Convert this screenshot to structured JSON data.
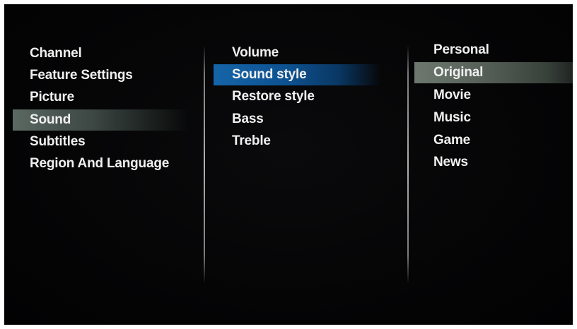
{
  "main_menu": {
    "items": [
      {
        "label": "Channel"
      },
      {
        "label": "Feature Settings"
      },
      {
        "label": "Picture"
      },
      {
        "label": "Sound"
      },
      {
        "label": "Subtitles"
      },
      {
        "label": "Region And Language"
      }
    ],
    "selected": "Sound"
  },
  "sound_menu": {
    "items": [
      {
        "label": "Volume"
      },
      {
        "label": "Sound style"
      },
      {
        "label": "Restore style"
      },
      {
        "label": "Bass"
      },
      {
        "label": "Treble"
      }
    ],
    "selected": "Sound style"
  },
  "sound_style_menu": {
    "items": [
      {
        "label": "Personal"
      },
      {
        "label": "Original"
      },
      {
        "label": "Movie"
      },
      {
        "label": "Music"
      },
      {
        "label": "Game"
      },
      {
        "label": "News"
      }
    ],
    "selected": "Original"
  },
  "colors": {
    "background": "#050506",
    "text": "#f0f0f0",
    "focus_highlight": "#1565a8",
    "path_highlight": "#5b6862",
    "option_highlight": "#6d786f"
  }
}
